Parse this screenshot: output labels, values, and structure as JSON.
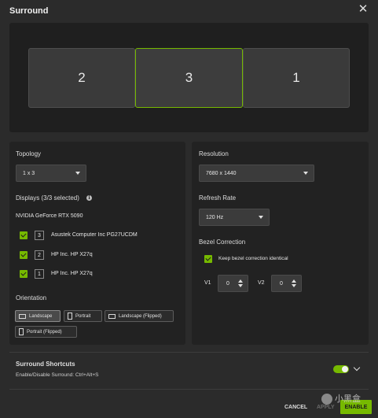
{
  "dialog": {
    "title": "Surround"
  },
  "preview": {
    "monitors": [
      "2",
      "3",
      "1"
    ],
    "selected": "3"
  },
  "topology": {
    "label": "Topology",
    "value": "1 x 3"
  },
  "displays": {
    "label": "Displays (3/3 selected)",
    "info_glyph": "i",
    "gpu": "NVIDIA GeForce RTX 5090",
    "items": [
      {
        "number": "3",
        "name": "Asustek Computer Inc PG27UCDM",
        "checked": true
      },
      {
        "number": "2",
        "name": "HP Inc. HP X27q",
        "checked": true
      },
      {
        "number": "1",
        "name": "HP Inc. HP X27q",
        "checked": true
      }
    ]
  },
  "orientation": {
    "label": "Orientation",
    "options": [
      "Landscape",
      "Portrait",
      "Landscape (Flipped)",
      "Portrait (Flipped)"
    ],
    "selected": "Landscape"
  },
  "resolution": {
    "label": "Resolution",
    "value": "7680 x 1440"
  },
  "refresh_rate": {
    "label": "Refresh Rate",
    "value": "120 Hz"
  },
  "bezel": {
    "label": "Bezel Correction",
    "identical_label": "Keep bezel correction identical",
    "identical_checked": true,
    "v1_label": "V1",
    "v1_value": "0",
    "v2_label": "V2",
    "v2_value": "0"
  },
  "shortcuts": {
    "title": "Surround Shortcuts",
    "description": "Enable/Disable Surround: Ctrl+Alt+S",
    "enabled": true
  },
  "footer": {
    "cancel": "CANCEL",
    "apply": "APPLY",
    "enable": "ENABLE"
  },
  "watermark": {
    "text": "小黑盒"
  },
  "colors": {
    "accent": "#76b900",
    "background": "#2b2b2b",
    "panel": "#222222"
  }
}
